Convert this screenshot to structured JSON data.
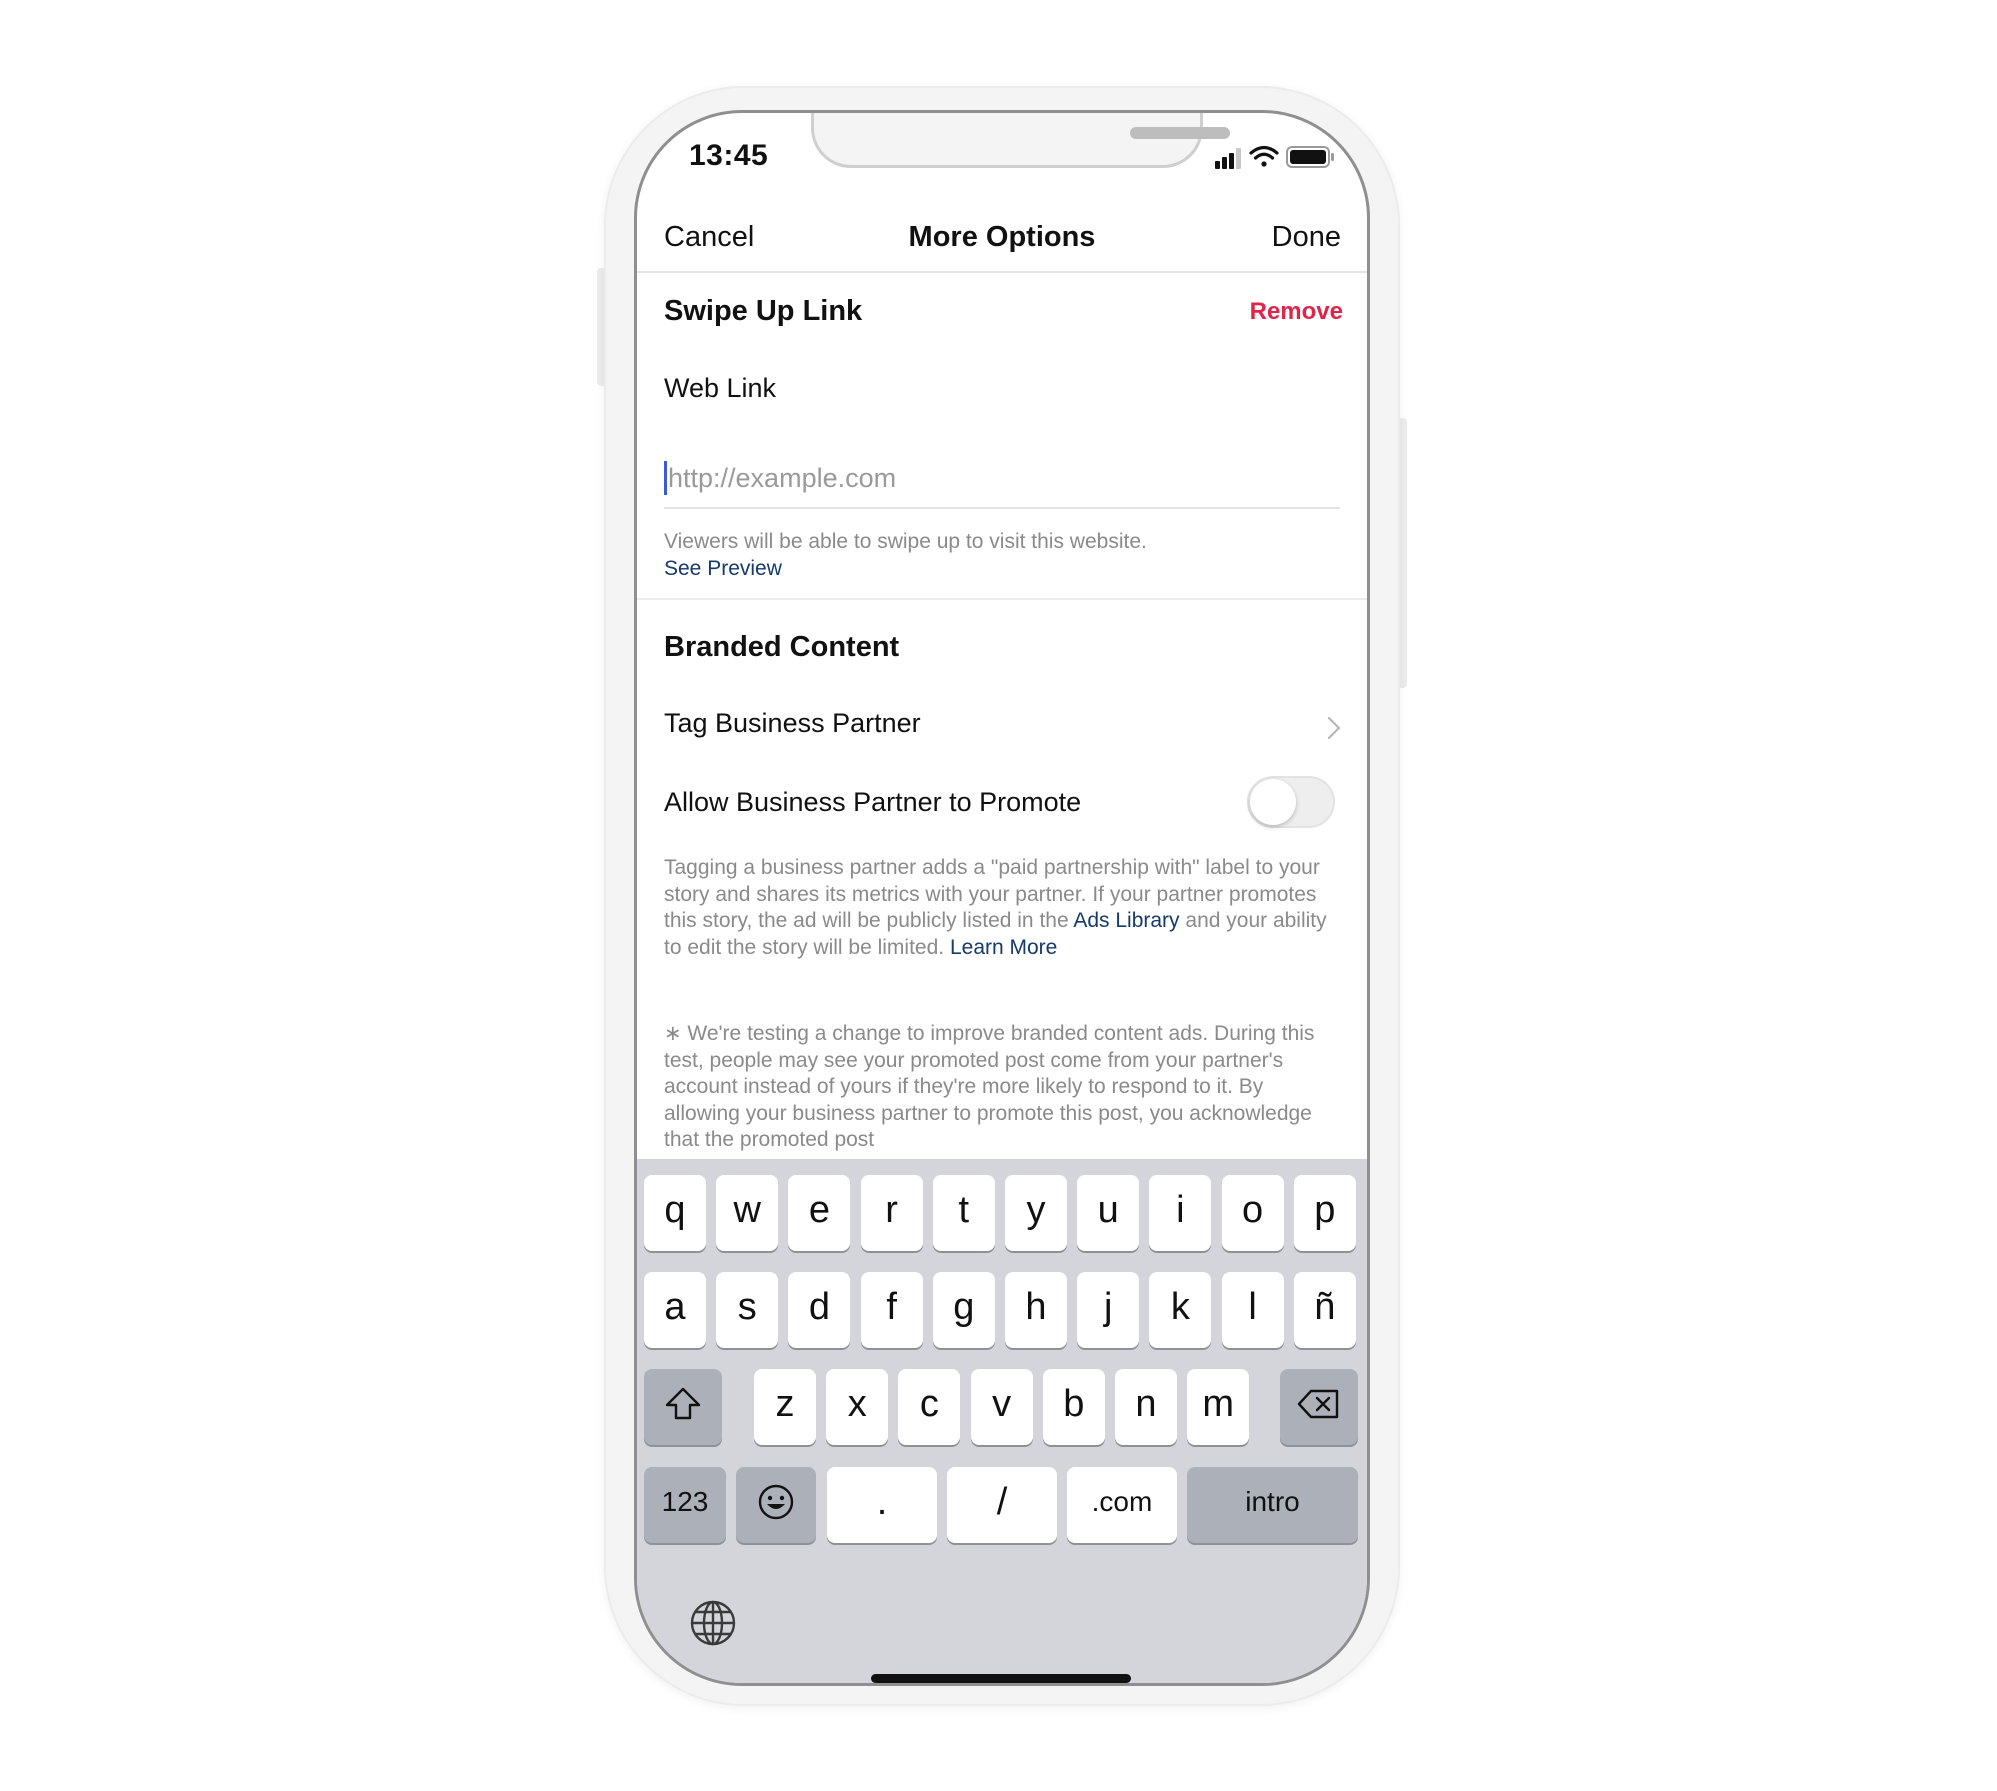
{
  "status_bar": {
    "time": "13:45",
    "icons": [
      "cellular-signal-icon",
      "wifi-icon",
      "battery-icon"
    ]
  },
  "nav": {
    "cancel_label": "Cancel",
    "title": "More Options",
    "done_label": "Done"
  },
  "swipe_up": {
    "title": "Swipe Up Link",
    "remove_label": "Remove",
    "web_link_label": "Web Link",
    "url_placeholder": "http://example.com",
    "url_value": "",
    "help_text": "Viewers will be able to swipe up to visit this website.",
    "preview_link": "See Preview"
  },
  "branded": {
    "title": "Branded Content",
    "tag_partner_label": "Tag Business Partner",
    "allow_promote_label": "Allow Business Partner to Promote",
    "allow_promote_on": false,
    "disclaimer_part1": "Tagging a business partner adds a \"paid partnership with\" label to your story and shares its metrics with your partner. If your partner promotes this story, the ad will be publicly listed in the",
    "ads_library_link": "Ads Library",
    "disclaimer_part2": "and your ability to edit the story will be limited.",
    "learn_more_link": "Learn More",
    "test_note": "∗ We're testing a change to improve branded content ads. During this test, people may see your promoted post come from your partner's account instead of yours if they're more likely to respond to it. By allowing your business partner to promote this post, you acknowledge that the promoted post"
  },
  "keyboard": {
    "row1": [
      "q",
      "w",
      "e",
      "r",
      "t",
      "y",
      "u",
      "i",
      "o",
      "p"
    ],
    "row2": [
      "a",
      "s",
      "d",
      "f",
      "g",
      "h",
      "j",
      "k",
      "l",
      "ñ"
    ],
    "row3": [
      "z",
      "x",
      "c",
      "v",
      "b",
      "n",
      "m"
    ],
    "numbers_label": "123",
    "dot_label": ".",
    "slash_label": "/",
    "dotcom_label": ".com",
    "return_label": "intro"
  },
  "colors": {
    "remove_red": "#e0244a",
    "link_blue": "#163a6c",
    "caret_blue": "#3b5bdb",
    "keyboard_bg": "#d3d5da"
  }
}
